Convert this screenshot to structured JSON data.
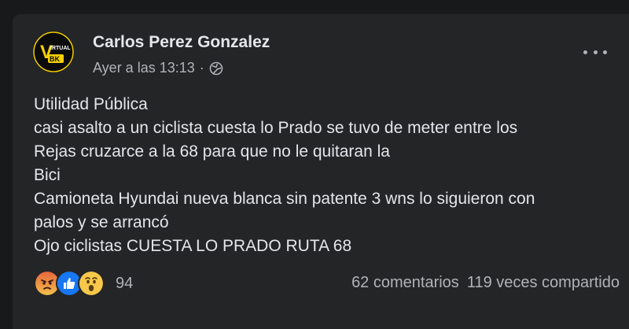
{
  "post": {
    "author": "Carlos Perez Gonzalez",
    "timestamp": "Ayer a las 13:13",
    "separator": "·",
    "privacy_icon": "globe-icon",
    "avatar": {
      "logo_text_top": "IRTUAL",
      "logo_letter": "V",
      "logo_text_bottom": "BK"
    },
    "lines": [
      "Utilidad Pública",
      "casi asalto a un ciclista cuesta lo Prado se tuvo de meter entre los",
      "Rejas cruzarce a la 68 para que no le quitaran la",
      "Bici",
      "Camioneta Hyundai nueva blanca sin patente 3 wns lo siguieron con",
      "palos y se arrancó",
      "Ojo ciclistas CUESTA LO PRADO RUTA 68"
    ],
    "reactions": {
      "icons": [
        "angry-reaction-icon",
        "like-reaction-icon",
        "wow-reaction-icon"
      ],
      "count": "94"
    },
    "comments": "62 comentarios",
    "shares": "119 veces compartido"
  },
  "colors": {
    "background": "#18191a",
    "card": "#242526",
    "primary_text": "#e4e6eb",
    "secondary_text": "#b0b3b8",
    "logo_yellow": "#f5d000",
    "like_blue": "#1877f2",
    "angry_orange": "#e8663d",
    "wow_yellow": "#f7c84a"
  }
}
